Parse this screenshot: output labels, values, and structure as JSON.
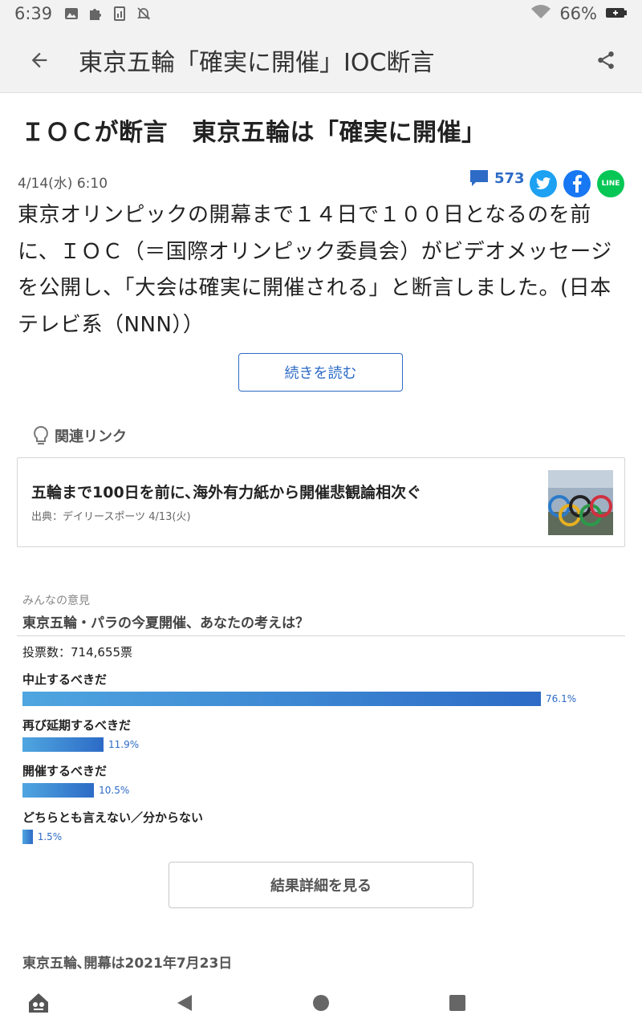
{
  "status_bar": {
    "time": "6:39",
    "battery": "66%",
    "icons": [
      "image-icon",
      "puzzle-icon",
      "chart-file-icon",
      "notifications-off-icon",
      "wifi-icon",
      "battery-icon"
    ]
  },
  "app_bar": {
    "title": "東京五輪「確実に開催」IOC断言",
    "back_icon": "arrow-back-icon",
    "share_icon": "share-icon"
  },
  "article": {
    "headline": "ＩＯＣが断言　東京五輪は「確実に開催」",
    "date": "4/14(水) 6:10",
    "comment_count": "573",
    "body": "東京オリンピックの開幕まで１４日で１００日となるのを前に、ＩＯＣ（＝国際オリンピック委員会）がビデオメッセージを公開し、「大会は確実に開催される」と断言しました。(日本テレビ系（NNN））",
    "read_more": "続きを読む",
    "share_buttons": [
      "twitter-icon",
      "facebook-icon",
      "line-icon"
    ],
    "line_label": "LINE"
  },
  "related": {
    "label": "関連リンク",
    "card": {
      "title": "五輪まで100日を前に､海外有力紙から開催悲観論相次ぐ",
      "source": "出典：デイリースポーツ 4/13(火)"
    }
  },
  "poll": {
    "label": "みんなの意見",
    "question": "東京五輪・パラの今夏開催、あなたの考えは？",
    "votes": "投票数：714,655票",
    "options": [
      {
        "label": "中止するべきだ",
        "percent_text": "76.1%",
        "value": 76.1
      },
      {
        "label": "再び延期するべきだ",
        "percent_text": "11.9%",
        "value": 11.9
      },
      {
        "label": "開催するべきだ",
        "percent_text": "10.5%",
        "value": 10.5
      },
      {
        "label": "どちらとも言えない／分からない",
        "percent_text": "1.5%",
        "value": 1.5
      }
    ],
    "detail_button": "結果詳細を見る"
  },
  "next_section": {
    "heading": "東京五輪､開幕は2021年7月23日"
  },
  "nav_bar": {
    "icons": [
      "app-home-icon",
      "back-triangle-icon",
      "home-circle-icon",
      "recents-square-icon"
    ]
  },
  "colors": {
    "accent": "#2d6bc6",
    "twitter": "#1da1f2",
    "facebook": "#1877f2",
    "line": "#06c755"
  }
}
